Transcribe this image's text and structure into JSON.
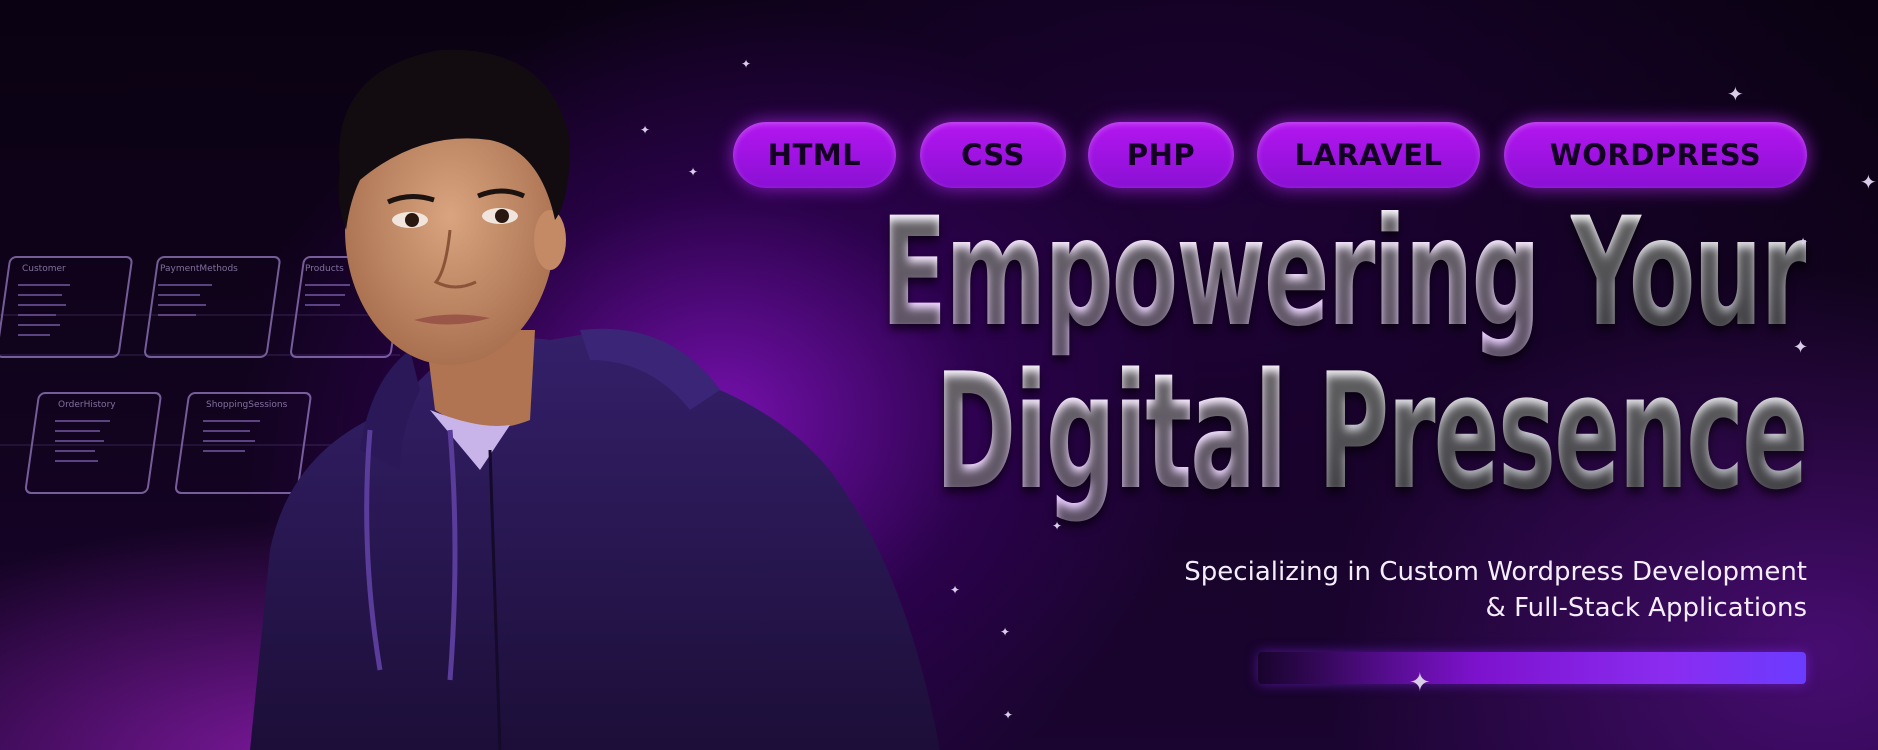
{
  "pills": [
    "HTML",
    "CSS",
    "PHP",
    "LARAVEL",
    "WORDPRESS"
  ],
  "headline": {
    "line1_a": "Empowering",
    "line1_b": "Your",
    "line2_a": "Digital",
    "line2_b": "Presence"
  },
  "subtitle": {
    "line1": "Specializing in Custom Wordpress Development",
    "line2": "& Full-Stack Applications"
  },
  "schema_tables": [
    "Customer",
    "PaymentMethods",
    "Products",
    "OrderHistory",
    "ShoppingSessions"
  ],
  "colors": {
    "pill": "#a812e6",
    "accent": "#8a2cf0",
    "background": "#07010f",
    "hoodie": "#241245"
  }
}
